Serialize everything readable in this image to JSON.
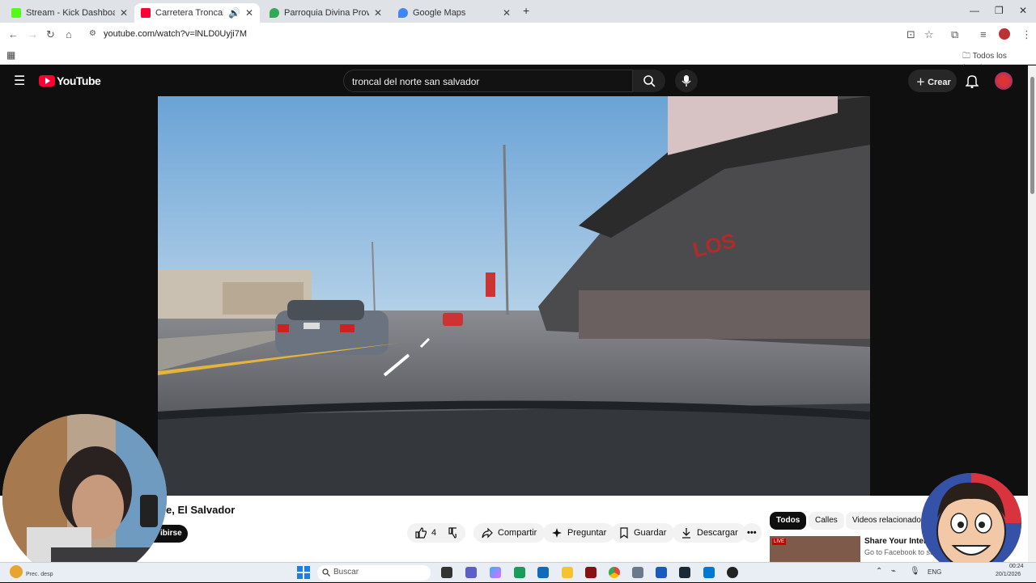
{
  "browser": {
    "tabs": [
      {
        "title": "Stream - Kick Dashboard",
        "favicon_color": "#53fc18",
        "active": false
      },
      {
        "title": "Carretera Troncal del Norte",
        "favicon_color": "#ff0033",
        "active": true
      },
      {
        "title": "Parroquia Divina Providencia -",
        "favicon_color": "#34a853",
        "active": false
      },
      {
        "title": "Google Maps",
        "favicon_color": "#4285f4",
        "active": false
      }
    ],
    "new_tab": "+",
    "url": "youtube.com/watch?v=lNLD0Uyji7M",
    "bookmarks_folder": "Todos los favoritos"
  },
  "youtube": {
    "logo_text": "YouTube",
    "search_value": "troncal del norte san salvador",
    "create_label": "Crear",
    "video_title_partial": "e, El Salvador",
    "subscribe_partial": "ibirse",
    "like_count": "4",
    "actions": {
      "share": "Compartir",
      "ask": "Preguntar",
      "save": "Guardar",
      "download": "Descargar"
    },
    "chips": [
      "Todos",
      "Calles",
      "Videos relacionados"
    ],
    "rec_title": "Share Your Intere",
    "rec_subtitle": "Go to Facebook to sta",
    "rec_badge": "LIVE"
  },
  "taskbar": {
    "search_placeholder": "Buscar",
    "weather": "Prec. desp",
    "lang": "ENG",
    "time": "00:24",
    "date": "20/1/2026"
  },
  "colors": {
    "yt_red": "#ff0033",
    "dark": "#0f0f0f",
    "accent": "#3ea6ff"
  }
}
